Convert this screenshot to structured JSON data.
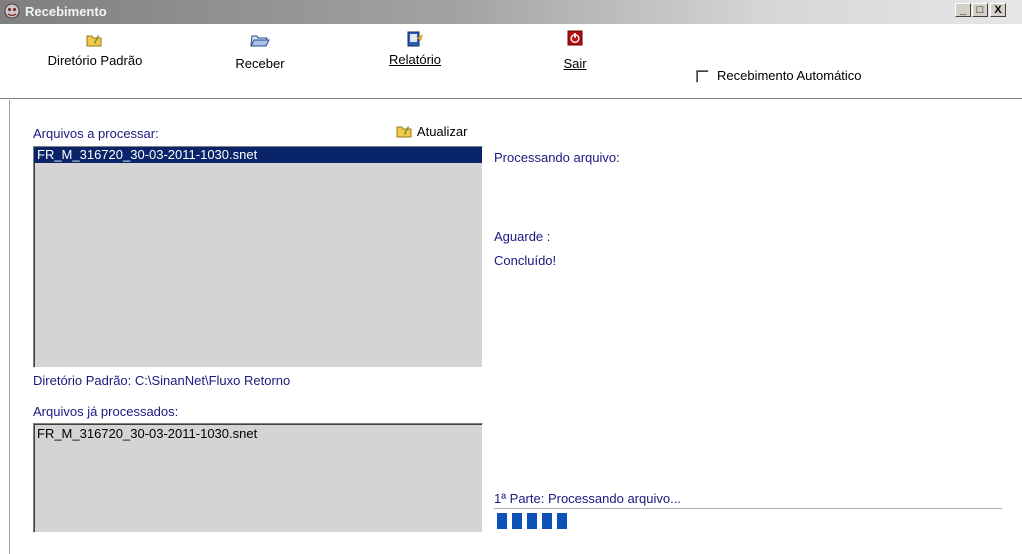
{
  "window": {
    "title": "Recebimento",
    "controls": [
      "_",
      "□",
      "X"
    ]
  },
  "toolbar": {
    "diretorio_label": "Diretório Padrão",
    "receber_label": "Receber",
    "relatorio_label": "Relatório",
    "sair_label": "Sair",
    "auto_label": "Recebimento Automático",
    "auto_checked": false
  },
  "left": {
    "to_process_label": "Arquivos a processar:",
    "refresh_label": "Atualizar",
    "to_process_items": [
      "FR_M_316720_30-03-2011-1030.snet"
    ],
    "default_dir_label": "Diretório Padrão: C:\\SinanNet\\Fluxo Retorno",
    "processed_label": "Arquivos já processados:",
    "processed_items": [
      "FR_M_316720_30-03-2011-1030.snet"
    ]
  },
  "right": {
    "processing_label": "Processando arquivo:",
    "wait_label": "Aguarde :",
    "done_label": "Concluído!",
    "part_label": "1ª Parte: Processando arquivo...",
    "progress_blocks_shown": 5
  },
  "colors": {
    "selection": "#0a246a",
    "label_blue": "#1a1a80",
    "progress_fill": "#0d52b9"
  }
}
